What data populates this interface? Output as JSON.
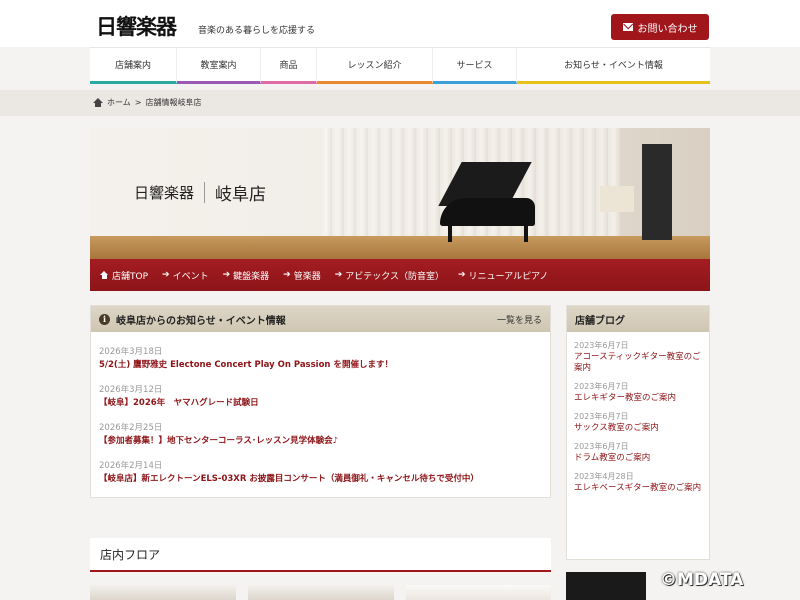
{
  "header": {
    "logo": "日響楽器",
    "tagline": "音楽のある暮らしを応援する",
    "contact_label": "お問い合わせ"
  },
  "nav": {
    "items": [
      {
        "label": "店舗案内",
        "color": "#2ca9a0"
      },
      {
        "label": "教室案内",
        "color": "#9b59b6"
      },
      {
        "label": "商品",
        "color": "#e06aa6"
      },
      {
        "label": "レッスン紹介",
        "color": "#e88a2e"
      },
      {
        "label": "サービス",
        "color": "#3aa0d8"
      },
      {
        "label": "お知らせ・イベント情報",
        "color": "#e6c21a"
      }
    ]
  },
  "breadcrumb": {
    "home": "ホーム",
    "separator": ">",
    "current": "店舗情報岐阜店"
  },
  "hero": {
    "brand": "日響楽器",
    "branch": "岐阜店"
  },
  "subnav": {
    "items": [
      {
        "label": "店舗TOP",
        "icon": "home-icon"
      },
      {
        "label": "イベント",
        "icon": "arrow-icon"
      },
      {
        "label": "鍵盤楽器",
        "icon": "arrow-icon"
      },
      {
        "label": "管楽器",
        "icon": "arrow-icon"
      },
      {
        "label": "アビテックス（防音室）",
        "icon": "arrow-icon"
      },
      {
        "label": "リニューアルピアノ",
        "icon": "arrow-icon"
      }
    ]
  },
  "news": {
    "title": "岐阜店からのお知らせ・イベント情報",
    "more_label": "一覧を見る",
    "items": [
      {
        "date": "2026年3月18日",
        "text": "5/2(土) 鷹野雅史 Electone Concert Play On Passion を開催します！"
      },
      {
        "date": "2026年3月12日",
        "text": "【岐阜】2026年　ヤマハグレード試験日"
      },
      {
        "date": "2026年2月25日",
        "text": "【参加者募集！】地下センターコーラス･レッスン見学体験会♪"
      },
      {
        "date": "2026年2月14日",
        "text": "【岐阜店】新エレクトーンELS-03XR お披露目コンサート（満員御礼・キャンセル待ちで受付中）"
      }
    ]
  },
  "blog": {
    "title": "店舗ブログ",
    "items": [
      {
        "date": "2023年6月7日",
        "text": "アコースティックギター教室のご案内"
      },
      {
        "date": "2023年6月7日",
        "text": "エレキギター教室のご案内"
      },
      {
        "date": "2023年6月7日",
        "text": "サックス教室のご案内"
      },
      {
        "date": "2023年6月7日",
        "text": "ドラム教室のご案内"
      },
      {
        "date": "2023年4月28日",
        "text": "エレキベースギター教室のご案内"
      }
    ]
  },
  "floor": {
    "title": "店内フロア"
  },
  "watermark": "©MDATA",
  "colors": {
    "accent": "#a0161b",
    "link": "#8e1418",
    "panel_head": "#d6cfbd"
  }
}
